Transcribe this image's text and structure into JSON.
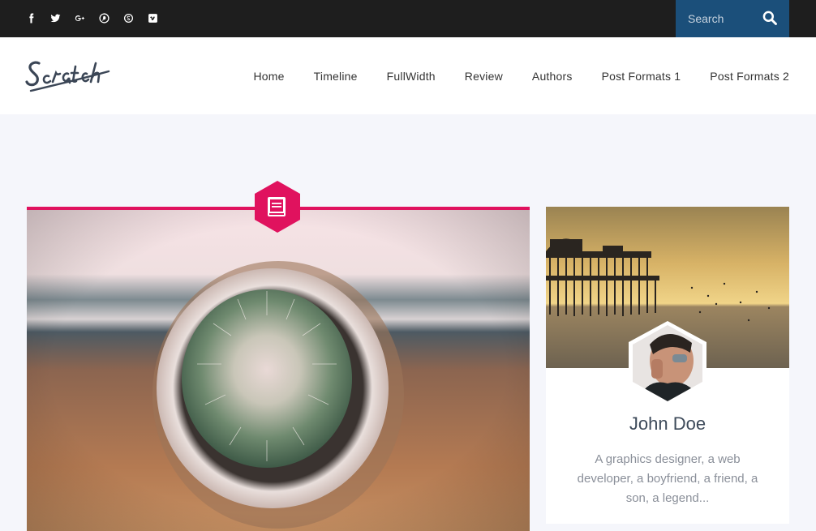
{
  "topbar": {
    "social": [
      {
        "icon": "facebook-icon"
      },
      {
        "icon": "twitter-icon"
      },
      {
        "icon": "google-plus-icon"
      },
      {
        "icon": "pinterest-icon"
      },
      {
        "icon": "skype-icon"
      },
      {
        "icon": "vimeo-icon"
      }
    ],
    "search": {
      "placeholder": "Search",
      "icon": "search-icon"
    }
  },
  "header": {
    "logo_text": "Scratch",
    "nav": [
      "Home",
      "Timeline",
      "FullWidth",
      "Review",
      "Authors",
      "Post Formats 1",
      "Post Formats 2"
    ]
  },
  "post": {
    "format_icon": "book-icon",
    "accent": "#e0125e"
  },
  "author_widget": {
    "name": "John Doe",
    "bio": "A graphics designer, a web developer, a boyfriend, a friend, a son, a legend..."
  },
  "colors": {
    "topbar": "#1e1e1e",
    "search_bg": "#1b4f7a",
    "page_bg": "#f5f6fb"
  }
}
